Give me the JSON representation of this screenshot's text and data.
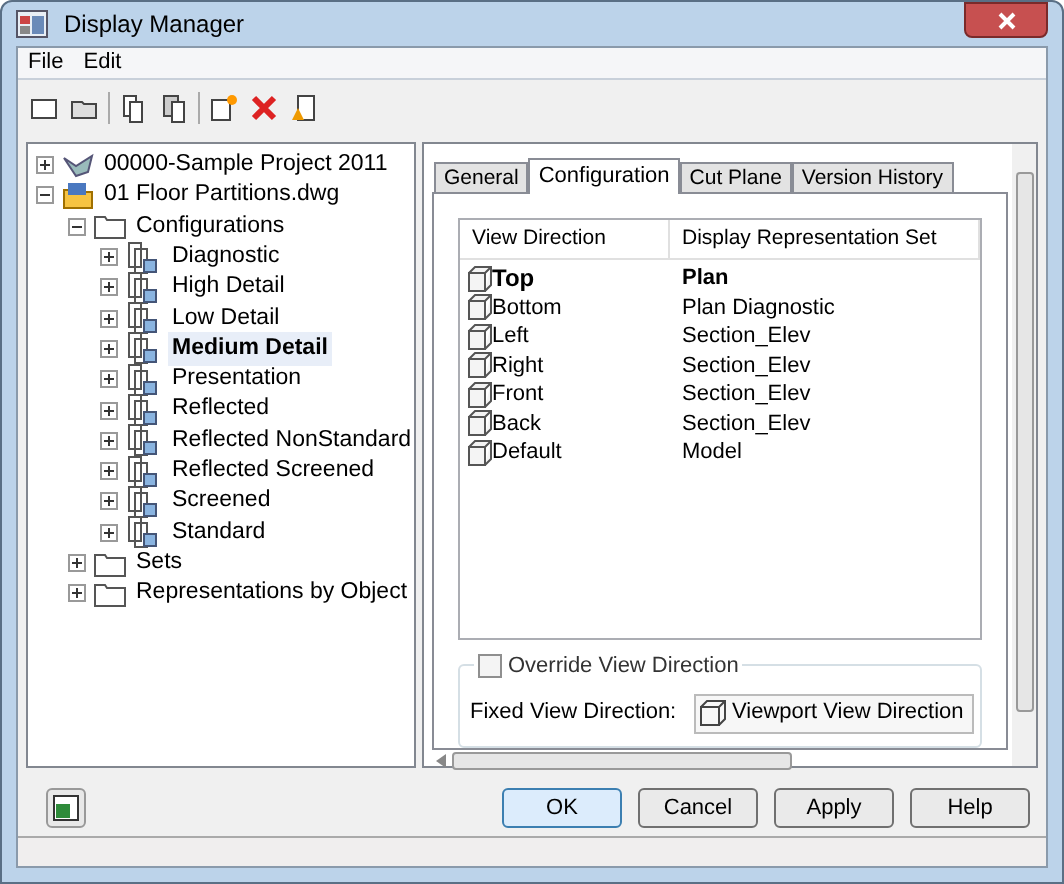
{
  "window": {
    "title": "Display Manager"
  },
  "menu": [
    "File",
    "Edit"
  ],
  "tree": [
    {
      "label": "00000-Sample Project 2011",
      "kind": "project",
      "expanded": false,
      "selected": false
    },
    {
      "label": "01 Floor Partitions.dwg",
      "kind": "drawing",
      "expanded": true,
      "selected": false,
      "children": [
        {
          "label": "Configurations",
          "kind": "folder",
          "expanded": true,
          "selected": false,
          "children": [
            {
              "label": "Diagnostic",
              "kind": "config",
              "expanded": false,
              "selected": false
            },
            {
              "label": "High Detail",
              "kind": "config",
              "expanded": false,
              "selected": false
            },
            {
              "label": "Low Detail",
              "kind": "config",
              "expanded": false,
              "selected": false
            },
            {
              "label": "Medium Detail",
              "kind": "config",
              "expanded": false,
              "selected": true
            },
            {
              "label": "Presentation",
              "kind": "config",
              "expanded": false,
              "selected": false
            },
            {
              "label": "Reflected",
              "kind": "config",
              "expanded": false,
              "selected": false
            },
            {
              "label": "Reflected NonStandard",
              "kind": "config",
              "expanded": false,
              "selected": false
            },
            {
              "label": "Reflected Screened",
              "kind": "config",
              "expanded": false,
              "selected": false
            },
            {
              "label": "Screened",
              "kind": "config",
              "expanded": false,
              "selected": false
            },
            {
              "label": "Standard",
              "kind": "config",
              "expanded": false,
              "selected": false
            }
          ]
        },
        {
          "label": "Sets",
          "kind": "folder",
          "expanded": false,
          "selected": false
        },
        {
          "label": "Representations by Object",
          "kind": "folder",
          "expanded": false,
          "selected": false
        }
      ]
    }
  ],
  "tabs": [
    {
      "label": "General",
      "selected": false
    },
    {
      "label": "Configuration",
      "selected": true
    },
    {
      "label": "Cut Plane",
      "selected": false
    },
    {
      "label": "Version History",
      "selected": false
    }
  ],
  "table": {
    "columns": [
      "View Direction",
      "Display Representation Set"
    ],
    "rows": [
      {
        "direction": "Top",
        "set": "Plan",
        "current": true
      },
      {
        "direction": "Bottom",
        "set": "Plan Diagnostic",
        "current": false
      },
      {
        "direction": "Left",
        "set": "Section_Elev",
        "current": false
      },
      {
        "direction": "Right",
        "set": "Section_Elev",
        "current": false
      },
      {
        "direction": "Front",
        "set": "Section_Elev",
        "current": false
      },
      {
        "direction": "Back",
        "set": "Section_Elev",
        "current": false
      },
      {
        "direction": "Default",
        "set": "Model",
        "current": false
      }
    ]
  },
  "override": {
    "label": "Override View Direction",
    "checked": false
  },
  "fixed_view": {
    "label": "Fixed View Direction:",
    "value": "Viewport View Direction"
  },
  "buttons": [
    "OK",
    "Cancel",
    "Apply",
    "Help"
  ]
}
